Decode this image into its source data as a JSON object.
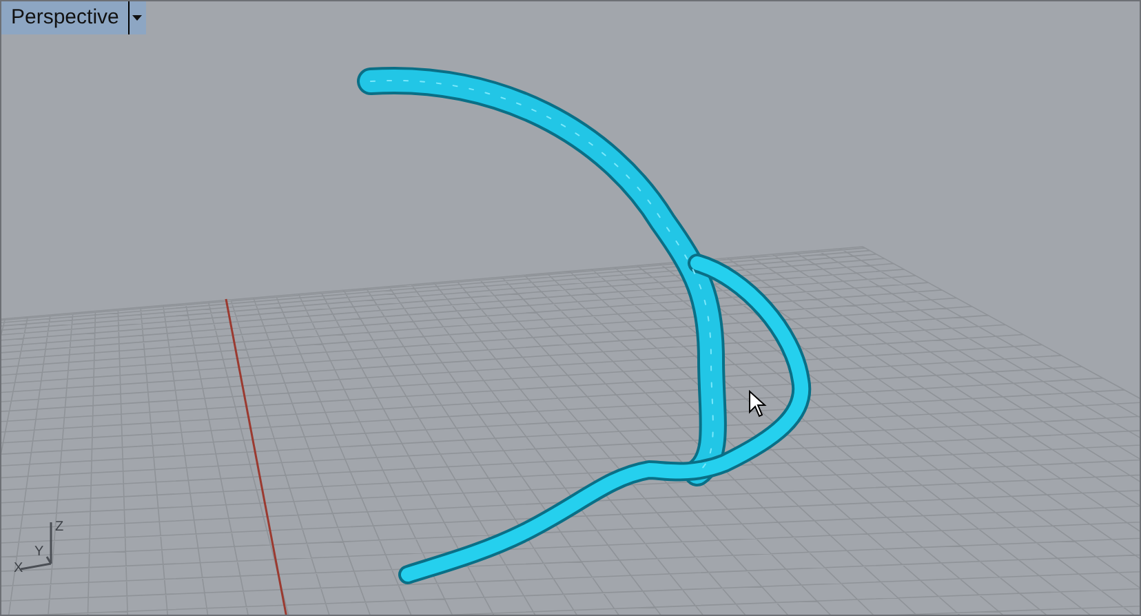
{
  "viewport": {
    "title": "Perspective"
  },
  "axis_labels": [
    {
      "kind": "z",
      "text": "Z"
    },
    {
      "kind": "y",
      "text": "Y"
    },
    {
      "kind": "x",
      "text": "X"
    }
  ]
}
